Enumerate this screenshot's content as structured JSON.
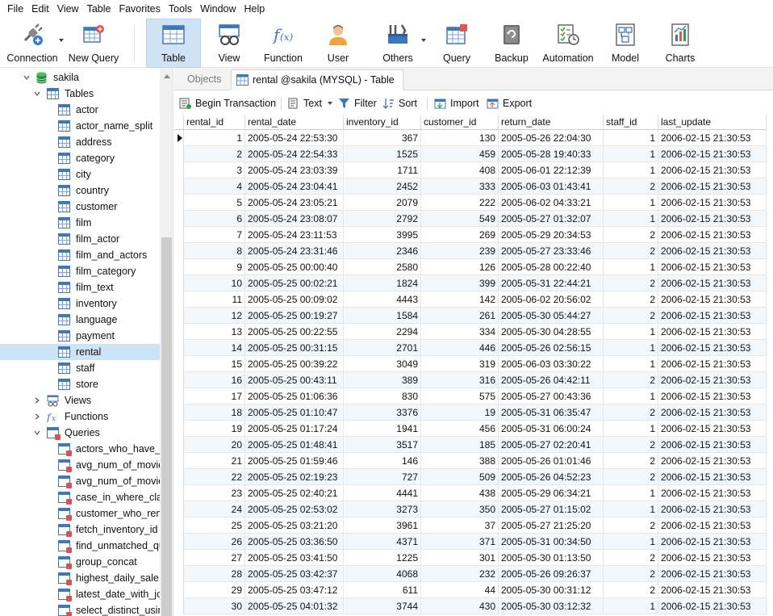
{
  "menu": [
    "File",
    "Edit",
    "View",
    "Table",
    "Favorites",
    "Tools",
    "Window",
    "Help"
  ],
  "toolbar": {
    "connection": "Connection",
    "new_query": "New Query",
    "table": "Table",
    "view": "View",
    "function": "Function",
    "user": "User",
    "others": "Others",
    "query": "Query",
    "backup": "Backup",
    "automation": "Automation",
    "model": "Model",
    "charts": "Charts"
  },
  "sidebar": {
    "database": "sakila",
    "tables_label": "Tables",
    "tables": [
      "actor",
      "actor_name_split",
      "address",
      "category",
      "city",
      "country",
      "customer",
      "film",
      "film_actor",
      "film_and_actors",
      "film_category",
      "film_text",
      "inventory",
      "language",
      "payment",
      "rental",
      "staff",
      "store"
    ],
    "selected_table": "rental",
    "views_label": "Views",
    "functions_label": "Functions",
    "queries_label": "Queries",
    "queries": [
      "actors_who_have_ap",
      "avg_num_of_movie",
      "avg_num_of_movie",
      "case_in_where_clau",
      "customer_who_rent",
      "fetch_inventory_id",
      "find_unmatched_qu",
      "group_concat",
      "highest_daily_sale",
      "latest_date_with_joi",
      "select_distinct_usin"
    ]
  },
  "tabs": {
    "objects": "Objects",
    "active": "rental @sakila (MYSQL) - Table"
  },
  "table_toolbar": {
    "begin_transaction": "Begin Transaction",
    "text": "Text",
    "filter": "Filter",
    "sort": "Sort",
    "import": "Import",
    "export": "Export"
  },
  "grid": {
    "columns": [
      "rental_id",
      "rental_date",
      "inventory_id",
      "customer_id",
      "return_date",
      "staff_id",
      "last_update"
    ],
    "rows": [
      [
        "1",
        "2005-05-24 22:53:30",
        "367",
        "130",
        "2005-05-26 22:04:30",
        "1",
        "2006-02-15 21:30:53"
      ],
      [
        "2",
        "2005-05-24 22:54:33",
        "1525",
        "459",
        "2005-05-28 19:40:33",
        "1",
        "2006-02-15 21:30:53"
      ],
      [
        "3",
        "2005-05-24 23:03:39",
        "1711",
        "408",
        "2005-06-01 22:12:39",
        "1",
        "2006-02-15 21:30:53"
      ],
      [
        "4",
        "2005-05-24 23:04:41",
        "2452",
        "333",
        "2005-06-03 01:43:41",
        "2",
        "2006-02-15 21:30:53"
      ],
      [
        "5",
        "2005-05-24 23:05:21",
        "2079",
        "222",
        "2005-06-02 04:33:21",
        "1",
        "2006-02-15 21:30:53"
      ],
      [
        "6",
        "2005-05-24 23:08:07",
        "2792",
        "549",
        "2005-05-27 01:32:07",
        "1",
        "2006-02-15 21:30:53"
      ],
      [
        "7",
        "2005-05-24 23:11:53",
        "3995",
        "269",
        "2005-05-29 20:34:53",
        "2",
        "2006-02-15 21:30:53"
      ],
      [
        "8",
        "2005-05-24 23:31:46",
        "2346",
        "239",
        "2005-05-27 23:33:46",
        "2",
        "2006-02-15 21:30:53"
      ],
      [
        "9",
        "2005-05-25 00:00:40",
        "2580",
        "126",
        "2005-05-28 00:22:40",
        "1",
        "2006-02-15 21:30:53"
      ],
      [
        "10",
        "2005-05-25 00:02:21",
        "1824",
        "399",
        "2005-05-31 22:44:21",
        "2",
        "2006-02-15 21:30:53"
      ],
      [
        "11",
        "2005-05-25 00:09:02",
        "4443",
        "142",
        "2005-06-02 20:56:02",
        "2",
        "2006-02-15 21:30:53"
      ],
      [
        "12",
        "2005-05-25 00:19:27",
        "1584",
        "261",
        "2005-05-30 05:44:27",
        "2",
        "2006-02-15 21:30:53"
      ],
      [
        "13",
        "2005-05-25 00:22:55",
        "2294",
        "334",
        "2005-05-30 04:28:55",
        "1",
        "2006-02-15 21:30:53"
      ],
      [
        "14",
        "2005-05-25 00:31:15",
        "2701",
        "446",
        "2005-05-26 02:56:15",
        "1",
        "2006-02-15 21:30:53"
      ],
      [
        "15",
        "2005-05-25 00:39:22",
        "3049",
        "319",
        "2005-06-03 03:30:22",
        "1",
        "2006-02-15 21:30:53"
      ],
      [
        "16",
        "2005-05-25 00:43:11",
        "389",
        "316",
        "2005-05-26 04:42:11",
        "2",
        "2006-02-15 21:30:53"
      ],
      [
        "17",
        "2005-05-25 01:06:36",
        "830",
        "575",
        "2005-05-27 00:43:36",
        "1",
        "2006-02-15 21:30:53"
      ],
      [
        "18",
        "2005-05-25 01:10:47",
        "3376",
        "19",
        "2005-05-31 06:35:47",
        "2",
        "2006-02-15 21:30:53"
      ],
      [
        "19",
        "2005-05-25 01:17:24",
        "1941",
        "456",
        "2005-05-31 06:00:24",
        "1",
        "2006-02-15 21:30:53"
      ],
      [
        "20",
        "2005-05-25 01:48:41",
        "3517",
        "185",
        "2005-05-27 02:20:41",
        "2",
        "2006-02-15 21:30:53"
      ],
      [
        "21",
        "2005-05-25 01:59:46",
        "146",
        "388",
        "2005-05-26 01:01:46",
        "2",
        "2006-02-15 21:30:53"
      ],
      [
        "22",
        "2005-05-25 02:19:23",
        "727",
        "509",
        "2005-05-26 04:52:23",
        "2",
        "2006-02-15 21:30:53"
      ],
      [
        "23",
        "2005-05-25 02:40:21",
        "4441",
        "438",
        "2005-05-29 06:34:21",
        "1",
        "2006-02-15 21:30:53"
      ],
      [
        "24",
        "2005-05-25 02:53:02",
        "3273",
        "350",
        "2005-05-27 01:15:02",
        "1",
        "2006-02-15 21:30:53"
      ],
      [
        "25",
        "2005-05-25 03:21:20",
        "3961",
        "37",
        "2005-05-27 21:25:20",
        "2",
        "2006-02-15 21:30:53"
      ],
      [
        "26",
        "2005-05-25 03:36:50",
        "4371",
        "371",
        "2005-05-31 00:34:50",
        "1",
        "2006-02-15 21:30:53"
      ],
      [
        "27",
        "2005-05-25 03:41:50",
        "1225",
        "301",
        "2005-05-30 01:13:50",
        "2",
        "2006-02-15 21:30:53"
      ],
      [
        "28",
        "2005-05-25 03:42:37",
        "4068",
        "232",
        "2005-05-26 09:26:37",
        "2",
        "2006-02-15 21:30:53"
      ],
      [
        "29",
        "2005-05-25 03:47:12",
        "611",
        "44",
        "2005-05-30 00:31:12",
        "2",
        "2006-02-15 21:30:53"
      ],
      [
        "30",
        "2005-05-25 04:01:32",
        "3744",
        "430",
        "2005-05-30 03:12:32",
        "1",
        "2006-02-15 21:30:53"
      ]
    ]
  },
  "colors": {
    "accent": "#3d78b9",
    "selection": "#cce4f7",
    "active_tool": "#cfe3f5",
    "alt_row": "#f3f8fd"
  }
}
